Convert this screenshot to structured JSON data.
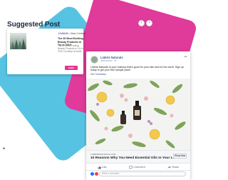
{
  "heading": "Suggested Post",
  "nav": {
    "prev": "‹",
    "next": "›"
  },
  "suggested": {
    "brand": "LIVALIS",
    "brand_link": "• View Content",
    "title": "The 30 Most Exciting Beauty Products to Try in 2019",
    "description": "The 30 Most Exciting Beauty Products to Try in 2019 Courtesy of brand",
    "button": "SHOP"
  },
  "post": {
    "page_name": "Liabris Naturals",
    "sponsored": "Sponsored · ⊕",
    "more": "•••",
    "text": "Liabris Naturals is your makeup that's good for your skin and for the earth. Sign up today to get your free sample pack!",
    "see_translation": "See Translation",
    "link_domain": "LIABRISNATURALS.COM",
    "link_title": "10 Reasons Why You Need Essential Oils In Your Life",
    "link_cta": "Shop Now",
    "actions": {
      "like": "Like",
      "comment": "Comment",
      "share": "Share"
    },
    "comment_placeholder": "Write a comment..."
  },
  "colors": {
    "blue_shape": "#57c3e3",
    "pink_shape": "#e03a9a",
    "cta": "#e3368f",
    "fb_link": "#365899"
  },
  "icons": [
    "chevron-left-icon",
    "chevron-right-icon",
    "more-icon",
    "like-icon",
    "comment-icon",
    "share-icon"
  ]
}
